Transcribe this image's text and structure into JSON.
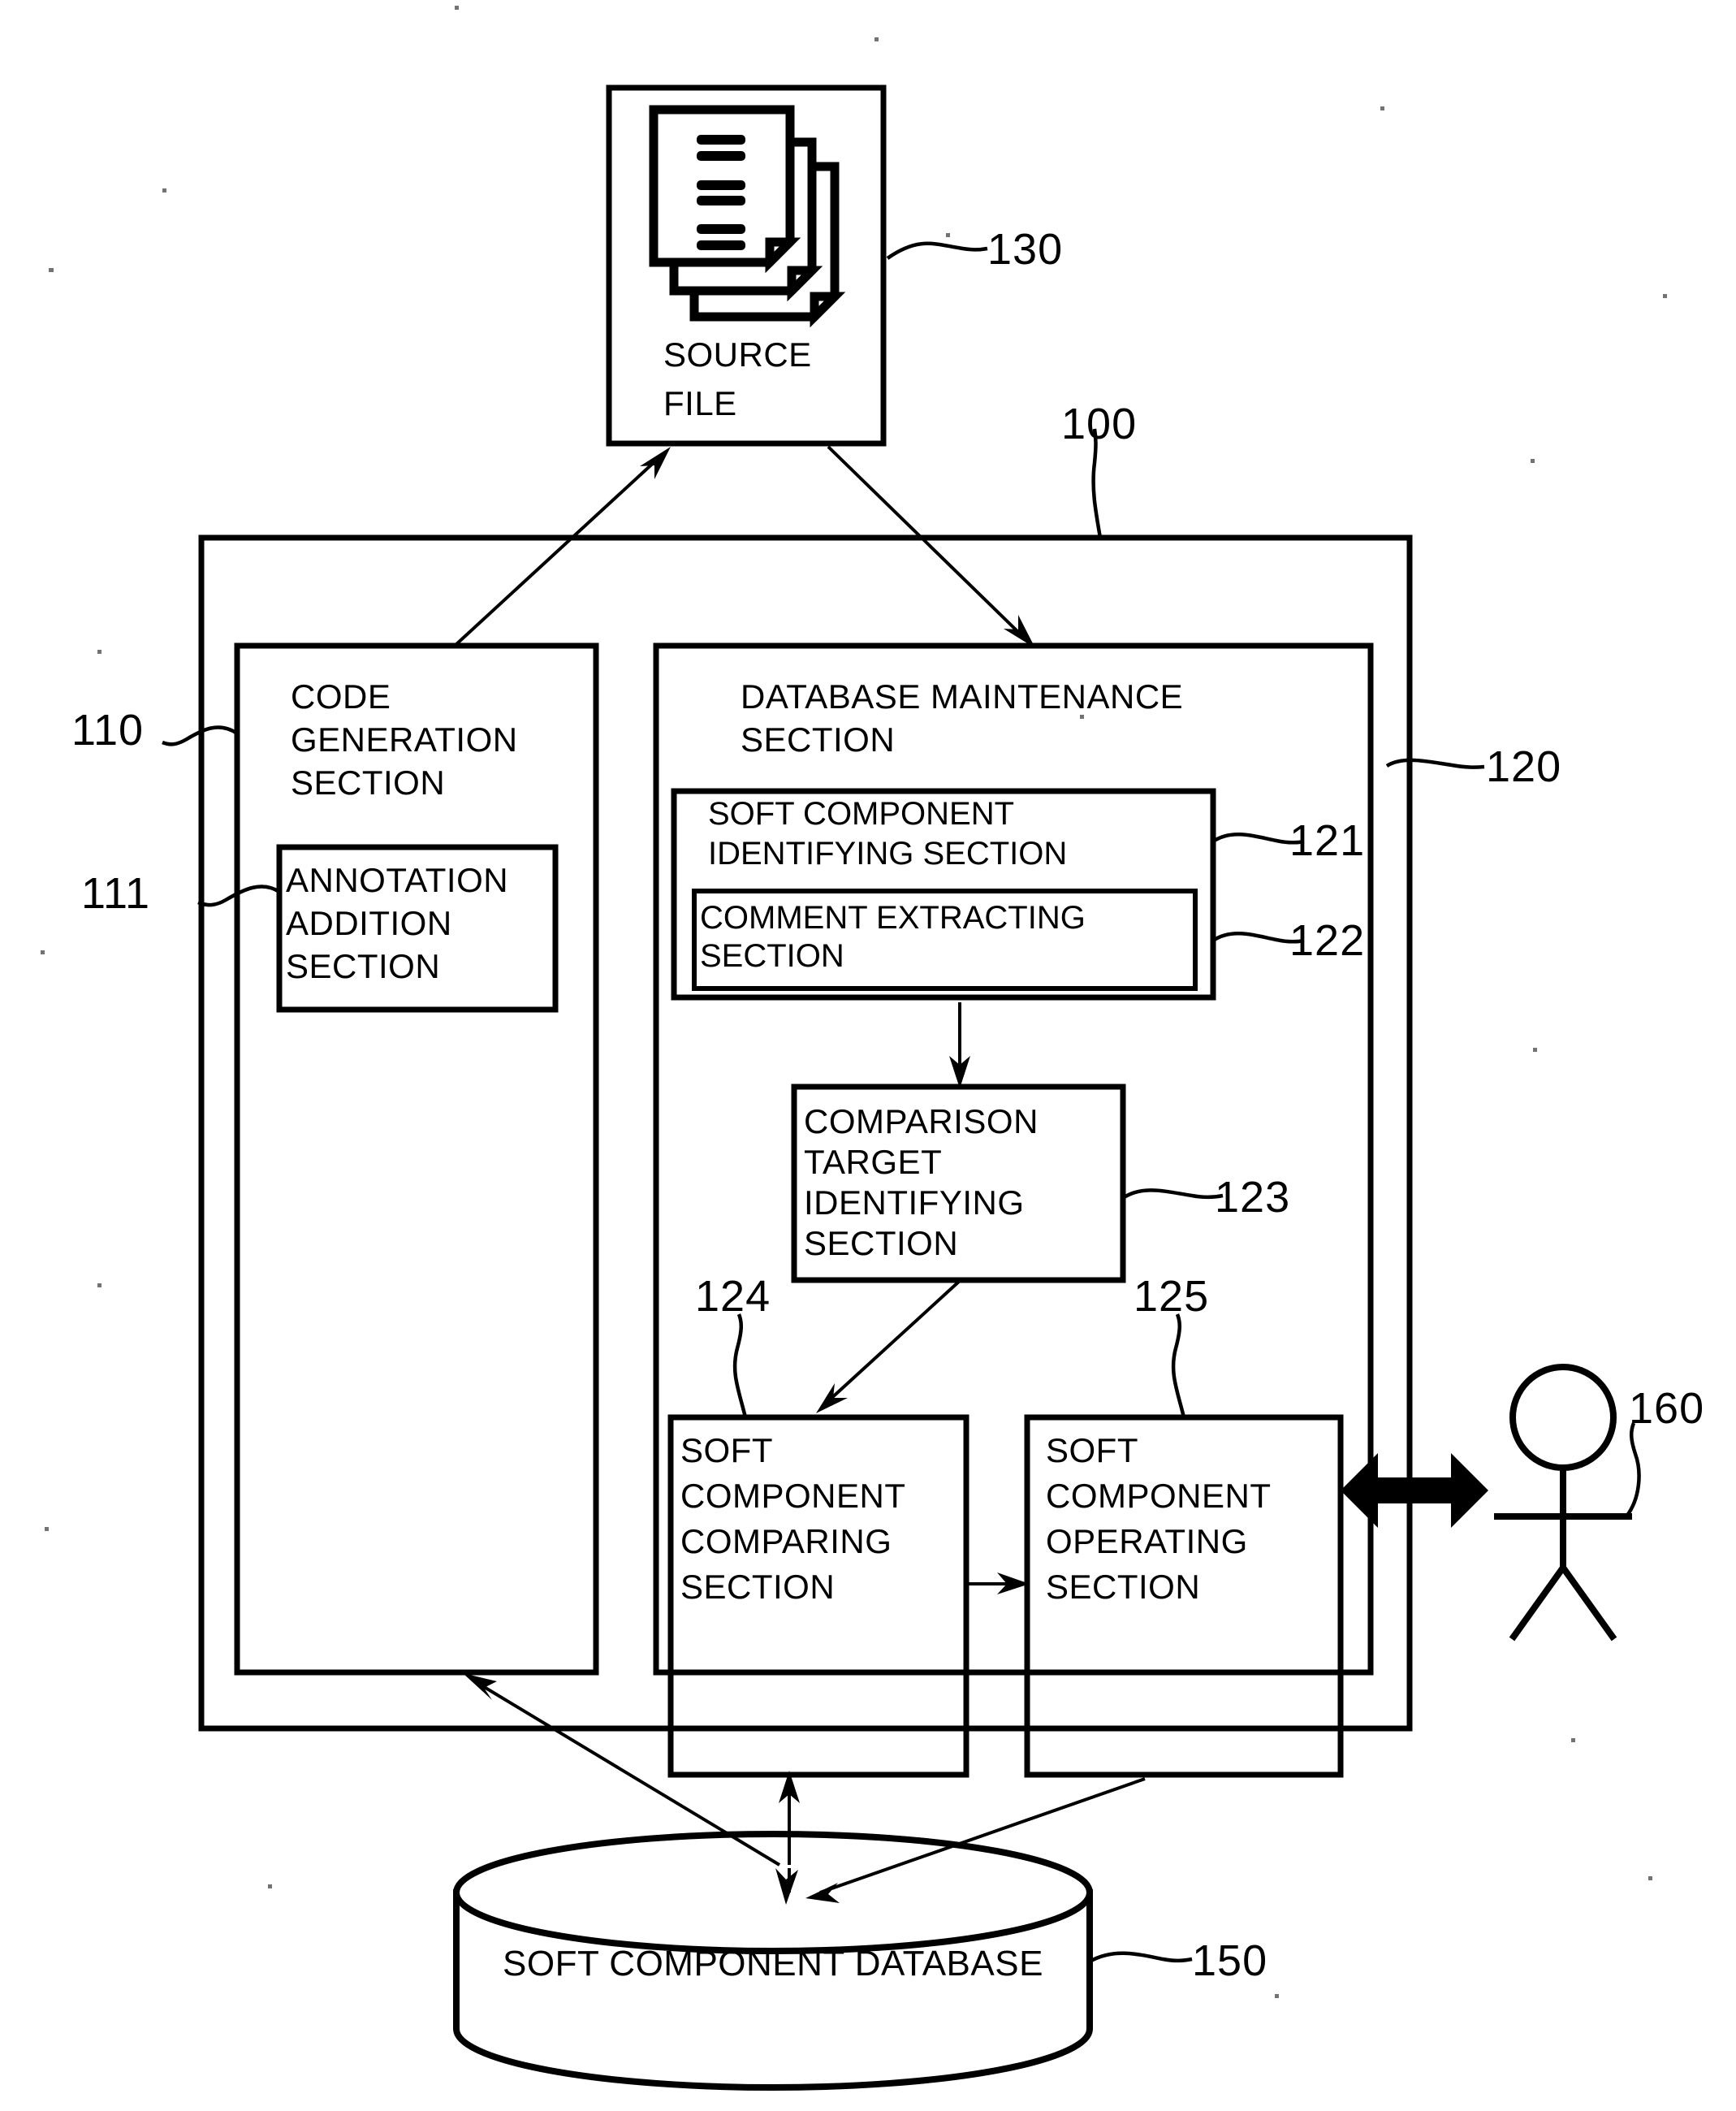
{
  "figure": {
    "type": "patent-block-diagram",
    "background_color": "#ffffff",
    "line_color": "#000000"
  },
  "source_file": {
    "label_line1": "SOURCE",
    "label_line2": "FILE",
    "icon": "document-stack-icon",
    "ref": "130"
  },
  "system": {
    "ref": "100"
  },
  "code_generation_section": {
    "title_line1": "CODE",
    "title_line2": "GENERATION",
    "title_line3": "SECTION",
    "ref": "110",
    "annotation_addition_section": {
      "title_line1": "ANNOTATION",
      "title_line2": "ADDITION",
      "title_line3": "SECTION",
      "ref": "111"
    }
  },
  "database_maintenance_section": {
    "title_line1": "DATABASE MAINTENANCE",
    "title_line2": "SECTION",
    "ref": "120",
    "soft_component_identifying_section": {
      "title_line1": "SOFT COMPONENT",
      "title_line2": "IDENTIFYING SECTION",
      "ref": "121"
    },
    "comment_extracting_section": {
      "title_line1": "COMMENT EXTRACTING",
      "title_line2": "SECTION",
      "ref": "122"
    },
    "comparison_target_identifying_section": {
      "title_line1": "COMPARISON",
      "title_line2": "TARGET",
      "title_line3": "IDENTIFYING",
      "title_line4": "SECTION",
      "ref": "123"
    },
    "soft_component_comparing_section": {
      "title_line1": "SOFT",
      "title_line2": "COMPONENT",
      "title_line3": "COMPARING",
      "title_line4": "SECTION",
      "ref": "124"
    },
    "soft_component_operating_section": {
      "title_line1": "SOFT",
      "title_line2": "COMPONENT",
      "title_line3": "OPERATING",
      "title_line4": "SECTION",
      "ref": "125"
    }
  },
  "soft_component_database": {
    "label": "SOFT COMPONENT DATABASE",
    "ref": "150",
    "icon": "database-cylinder-icon"
  },
  "user": {
    "icon": "stick-figure-person-icon",
    "ref": "160"
  },
  "connectors": {
    "bidirectional_user_arrow": "double-headed-arrow-icon"
  }
}
